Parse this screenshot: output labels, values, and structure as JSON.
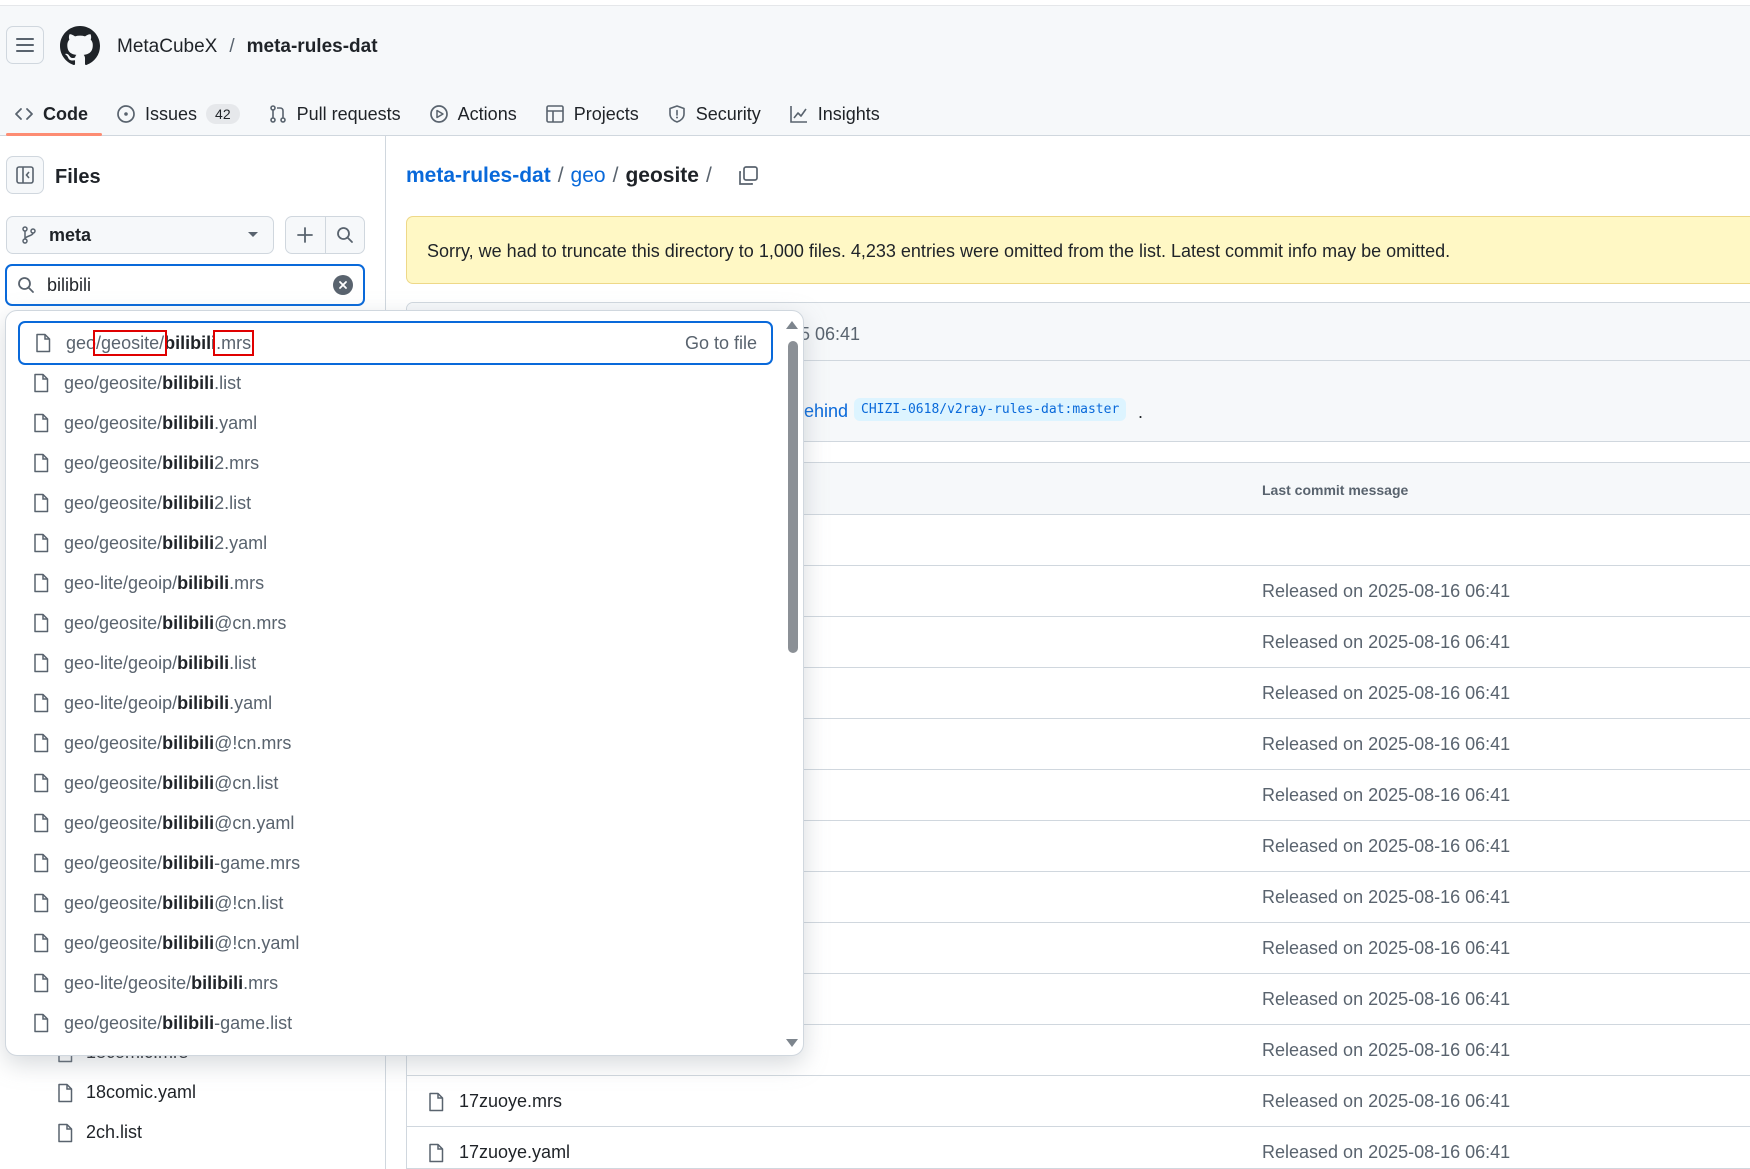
{
  "header": {
    "owner": "MetaCubeX",
    "separator": "/",
    "repo": "meta-rules-dat",
    "tabs": [
      {
        "label": "Code",
        "icon": "code-icon"
      },
      {
        "label": "Issues",
        "icon": "issue-icon",
        "count": "42"
      },
      {
        "label": "Pull requests",
        "icon": "pull-request-icon"
      },
      {
        "label": "Actions",
        "icon": "play-icon"
      },
      {
        "label": "Projects",
        "icon": "table-icon"
      },
      {
        "label": "Security",
        "icon": "shield-icon"
      },
      {
        "label": "Insights",
        "icon": "graph-icon"
      }
    ]
  },
  "sidebar": {
    "title": "Files",
    "branch": "meta",
    "search_value": "bilibili",
    "tree_items": [
      "18comic.mrs",
      "18comic.yaml",
      "2ch.list"
    ]
  },
  "breadcrumb": {
    "root": "meta-rules-dat",
    "sep": "/",
    "dir": "geo",
    "current": "geosite"
  },
  "notice": "Sorry, we had to truncate this directory to 1,000 files. 4,233 entries were omitted from the list. Latest commit info may be omitted.",
  "commit": {
    "time": "5 06:41",
    "behind_text": "ehind",
    "branch_ref": "CHIZI-0618/v2ray-rules-dat:master",
    "period": "."
  },
  "table": {
    "col_msg": "Last commit message",
    "rows": [
      {
        "name": "",
        "msg": ""
      },
      {
        "name": "",
        "msg": "Released on 2025-08-16 06:41"
      },
      {
        "name": "",
        "msg": "Released on 2025-08-16 06:41"
      },
      {
        "name": "",
        "msg": "Released on 2025-08-16 06:41"
      },
      {
        "name": "",
        "msg": "Released on 2025-08-16 06:41"
      },
      {
        "name": "",
        "msg": "Released on 2025-08-16 06:41"
      },
      {
        "name": "",
        "msg": "Released on 2025-08-16 06:41"
      },
      {
        "name": "",
        "msg": "Released on 2025-08-16 06:41"
      },
      {
        "name": "",
        "msg": "Released on 2025-08-16 06:41"
      },
      {
        "name": "",
        "msg": "Released on 2025-08-16 06:41"
      },
      {
        "name": "",
        "msg": "Released on 2025-08-16 06:41"
      },
      {
        "name": "17zuoye.mrs",
        "msg": "Released on 2025-08-16 06:41"
      },
      {
        "name": "17zuoye.yaml",
        "msg": "Released on 2025-08-16 06:41"
      }
    ]
  },
  "dropdown": {
    "goto_label": "Go to file",
    "results": [
      {
        "pre": "geo",
        "mid": "/geosite/",
        "bold": "bilibili",
        "post": ".mrs"
      },
      {
        "pre": "geo/geosite/",
        "mid": "",
        "bold": "bilibili",
        "post": ".list"
      },
      {
        "pre": "geo/geosite/",
        "mid": "",
        "bold": "bilibili",
        "post": ".yaml"
      },
      {
        "pre": "geo/geosite/",
        "mid": "",
        "bold": "bilibili",
        "post": "2.mrs"
      },
      {
        "pre": "geo/geosite/",
        "mid": "",
        "bold": "bilibili",
        "post": "2.list"
      },
      {
        "pre": "geo/geosite/",
        "mid": "",
        "bold": "bilibili",
        "post": "2.yaml"
      },
      {
        "pre": "geo-lite/geoip/",
        "mid": "",
        "bold": "bilibili",
        "post": ".mrs"
      },
      {
        "pre": "geo/geosite/",
        "mid": "",
        "bold": "bilibili",
        "post": "@cn.mrs"
      },
      {
        "pre": "geo-lite/geoip/",
        "mid": "",
        "bold": "bilibili",
        "post": ".list"
      },
      {
        "pre": "geo-lite/geoip/",
        "mid": "",
        "bold": "bilibili",
        "post": ".yaml"
      },
      {
        "pre": "geo/geosite/",
        "mid": "",
        "bold": "bilibili",
        "post": "@!cn.mrs"
      },
      {
        "pre": "geo/geosite/",
        "mid": "",
        "bold": "bilibili",
        "post": "@cn.list"
      },
      {
        "pre": "geo/geosite/",
        "mid": "",
        "bold": "bilibili",
        "post": "@cn.yaml"
      },
      {
        "pre": "geo/geosite/",
        "mid": "",
        "bold": "bilibili",
        "post": "-game.mrs"
      },
      {
        "pre": "geo/geosite/",
        "mid": "",
        "bold": "bilibili",
        "post": "@!cn.list"
      },
      {
        "pre": "geo/geosite/",
        "mid": "",
        "bold": "bilibili",
        "post": "@!cn.yaml"
      },
      {
        "pre": "geo-lite/geosite/",
        "mid": "",
        "bold": "bilibili",
        "post": ".mrs"
      },
      {
        "pre": "geo/geosite/",
        "mid": "",
        "bold": "bilibili",
        "post": "-game.list"
      }
    ]
  },
  "colors": {
    "accent": "#0969da",
    "tab_underline": "#fd8c73",
    "notice_bg": "#fff8c5",
    "highlight_box": "#e00000"
  }
}
